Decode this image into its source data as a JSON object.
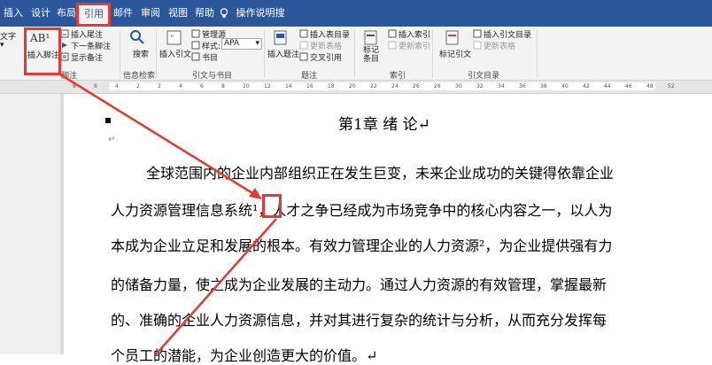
{
  "tabs": [
    "插入",
    "设计",
    "布局",
    "引用",
    "邮件",
    "审阅",
    "视图",
    "帮助",
    "操作说明搜索"
  ],
  "active_tab_index": 3,
  "ribbon": {
    "toc_label": "文字",
    "insert_footnote": "插入脚注",
    "footnote_icon_text": "AB¹",
    "insert_endnote": "插入尾注",
    "next_footnote": "下一条脚注",
    "show_notes": "显示备注",
    "footnote_group": "脚注",
    "search": "搜索",
    "search_group": "信息检索",
    "insert_citation": "插入引文",
    "manage_sources": "管理源",
    "style_label": "样式:",
    "style_value": "APA",
    "bibliography": "书目",
    "citations_group": "引文与书目",
    "insert_caption": "插入题注",
    "insert_table_of_figures": "插入表目录",
    "update_table": "更新表格",
    "cross_reference": "交叉引用",
    "captions_group": "题注",
    "mark_entry": "标记条目",
    "insert_index": "插入索引",
    "update_index": "更新索引",
    "index_group": "索引",
    "mark_citation": "标记引文",
    "insert_toa": "插入引文目录",
    "update_toa": "更新表格",
    "toa_group": "引文目录"
  },
  "ruler_ticks": [
    "8",
    "6",
    "4",
    "2",
    "2",
    "4",
    "6",
    "8",
    "10",
    "12",
    "14",
    "16",
    "18",
    "20",
    "22",
    "24",
    "26",
    "28",
    "30",
    "32",
    "34",
    "36",
    "38",
    "40",
    "42",
    "44",
    "46",
    "48",
    "52"
  ],
  "document": {
    "chapter_title": "第1章  绪 论↵",
    "lines": [
      "全球范围内的企业内部组织正在发生巨变，未来企业成功的关键得依靠企业",
      "人力资源管理信息系统¹，人才之争已经成为市场竞争中的核心内容之一，以人为",
      "本成为企业立足和发展的根本。有效力管理企业的人力资源²，为企业提供强有力",
      "的储备力量，使之成为企业发展的主动力。通过人力资源的有效管理，掌握最新",
      "的、准确的企业人力资源信息，并对其进行复杂的统计与分析，从而充分发挥每",
      "个员工的潜能，为企业创造更大的价值。↵"
    ]
  },
  "colors": {
    "title_bar": "#2b579a",
    "ribbon_bg": "#f3f3f3",
    "annotation_red": "#e53935"
  }
}
